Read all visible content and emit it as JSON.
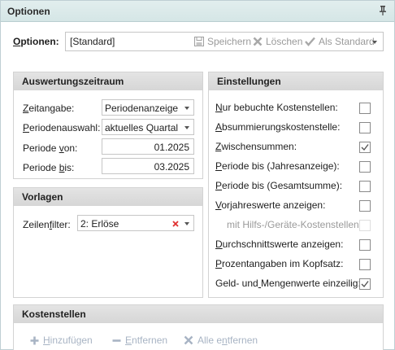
{
  "window": {
    "title": "Optionen"
  },
  "options": {
    "label": "Optionen:",
    "value": "[Standard]",
    "actions": {
      "save": "Speichern",
      "delete": "Löschen",
      "as_default": "Als Standard"
    }
  },
  "auswertung": {
    "title": "Auswertungszeitraum",
    "zeitangabe": {
      "label": "Zeitangabe:",
      "value": "Periodenanzeige"
    },
    "periodenauswahl": {
      "label": "Periodenauswahl:",
      "value": "aktuelles Quartal"
    },
    "periode_von": {
      "label": "Periode von:",
      "value": "01.2025"
    },
    "periode_bis": {
      "label": "Periode bis:",
      "value": "03.2025"
    }
  },
  "vorlagen": {
    "title": "Vorlagen",
    "zeilenfilter": {
      "label": "Zeilenfilter:",
      "value": "2: Erlöse"
    }
  },
  "einstellungen": {
    "title": "Einstellungen",
    "items": [
      {
        "label": "Nur bebuchte Kostenstellen:",
        "checked": false,
        "enabled": true
      },
      {
        "label": "Absummierungskostenstelle:",
        "checked": false,
        "enabled": true
      },
      {
        "label": "Zwischensummen:",
        "checked": true,
        "enabled": true
      },
      {
        "label": "Periode bis (Jahresanzeige):",
        "checked": false,
        "enabled": true
      },
      {
        "label": "Periode bis (Gesamtsumme):",
        "checked": false,
        "enabled": true
      },
      {
        "label": "Vorjahreswerte anzeigen:",
        "checked": false,
        "enabled": true
      },
      {
        "label": "mit Hilfs-/Geräte-Kostenstellen:",
        "checked": false,
        "enabled": false
      },
      {
        "label": "Durchschnittswerte anzeigen:",
        "checked": false,
        "enabled": true
      },
      {
        "label": "Prozentangaben im Kopfsatz:",
        "checked": false,
        "enabled": true
      },
      {
        "label": "Geld- und Mengenwerte einzeilig:",
        "checked": true,
        "enabled": true
      }
    ]
  },
  "kostenstellen": {
    "title": "Kostenstellen",
    "add": "Hinzufügen",
    "remove": "Entfernen",
    "remove_all": "Alle entfernen"
  },
  "colors": {
    "titlebar": "#d9e8e8",
    "panel_header": "#dcdcdc",
    "clear_x": "#e03030",
    "disabled_button": "#a8b4c4"
  }
}
